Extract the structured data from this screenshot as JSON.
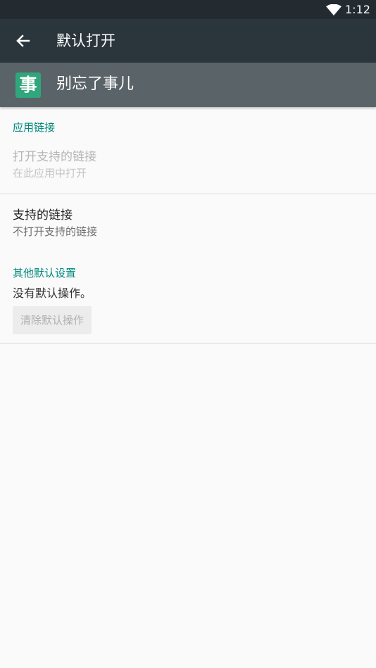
{
  "status_bar": {
    "time": "1:12",
    "wifi_icon": "wifi-icon"
  },
  "toolbar": {
    "back_icon": "arrow-left-icon",
    "title": "默认打开"
  },
  "app": {
    "icon_glyph": "事",
    "name": "别忘了事儿",
    "icon_color": "#2fa67b"
  },
  "app_links": {
    "section_title": "应用链接",
    "open_links_title": "打开支持的链接",
    "open_links_summary": "在此应用中打开",
    "supported_links_title": "支持的链接",
    "supported_links_summary": "不打开支持的链接"
  },
  "other_defaults": {
    "section_title": "其他默认设置",
    "no_default_text": "没有默认操作。",
    "clear_button_label": "清除默认操作"
  },
  "colors": {
    "status_bar": "#232b31",
    "toolbar": "#2b363c",
    "app_header": "#5a6468",
    "accent": "#00897b",
    "background": "#fafafa"
  }
}
